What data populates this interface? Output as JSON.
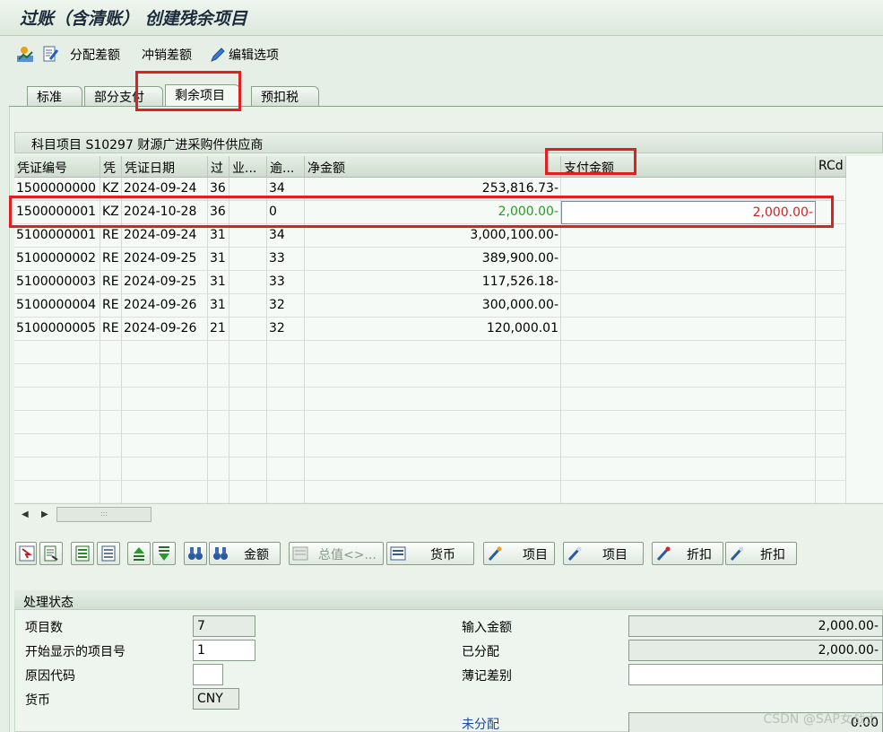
{
  "window": {
    "title": "过账（含清账） 创建残余项目"
  },
  "toolbar": {
    "assign_diff": "分配差额",
    "writeoff_diff": "冲销差额",
    "edit_options": "编辑选项"
  },
  "tabs": [
    {
      "label": "标准"
    },
    {
      "label": "部分支付"
    },
    {
      "label": "剩余项目",
      "active": true
    },
    {
      "label": "预扣税"
    }
  ],
  "table": {
    "caption": "科目项目 S10297 财源广进采购件供应商",
    "headers": [
      "凭证编号",
      "凭",
      "凭证日期",
      "过",
      "业...",
      "逾...",
      "净金额",
      "支付金额",
      "RCd"
    ],
    "rows": [
      {
        "doc": "1500000000",
        "type": "KZ",
        "date": "2024-09-24",
        "pk": "36",
        "bus": "",
        "overdue": "34",
        "net": "253,816.73-",
        "pay": ""
      },
      {
        "doc": "1500000001",
        "type": "KZ",
        "date": "2024-10-28",
        "pk": "36",
        "bus": "",
        "overdue": "0",
        "net": "2,000.00-",
        "pay": "2,000.00-"
      },
      {
        "doc": "5100000001",
        "type": "RE",
        "date": "2024-09-24",
        "pk": "31",
        "bus": "",
        "overdue": "34",
        "net": "3,000,100.00-",
        "pay": ""
      },
      {
        "doc": "5100000002",
        "type": "RE",
        "date": "2024-09-25",
        "pk": "31",
        "bus": "",
        "overdue": "33",
        "net": "389,900.00-",
        "pay": ""
      },
      {
        "doc": "5100000003",
        "type": "RE",
        "date": "2024-09-25",
        "pk": "31",
        "bus": "",
        "overdue": "33",
        "net": "117,526.18-",
        "pay": ""
      },
      {
        "doc": "5100000004",
        "type": "RE",
        "date": "2024-09-26",
        "pk": "31",
        "bus": "",
        "overdue": "32",
        "net": "300,000.00-",
        "pay": ""
      },
      {
        "doc": "5100000005",
        "type": "RE",
        "date": "2024-09-26",
        "pk": "21",
        "bus": "",
        "overdue": "32",
        "net": "120,000.01",
        "pay": ""
      }
    ]
  },
  "buttons": {
    "amount": "金额",
    "total": "总值<>...",
    "currency": "货币",
    "item1": "项目",
    "item2": "项目",
    "discount1": "折扣",
    "discount2": "折扣"
  },
  "status": {
    "title": "处理状态",
    "items_label": "项目数",
    "items_value": "7",
    "start_item_label": "开始显示的项目号",
    "start_item_value": "1",
    "reason_label": "原因代码",
    "reason_value": "",
    "currency_label": "货币",
    "currency_value": "CNY",
    "entered_label": "输入金额",
    "entered_value": "2,000.00-",
    "assigned_label": "已分配",
    "assigned_value": "2,000.00-",
    "posting_diff_label": "薄记差别",
    "posting_diff_value": "",
    "unassigned_label": "未分配",
    "unassigned_value": "0.00"
  },
  "watermark": "CSDN @SAP女战士",
  "colors": {
    "highlight": "#e02020",
    "green_value": "#2a9a2a",
    "red_value": "#d02020"
  }
}
